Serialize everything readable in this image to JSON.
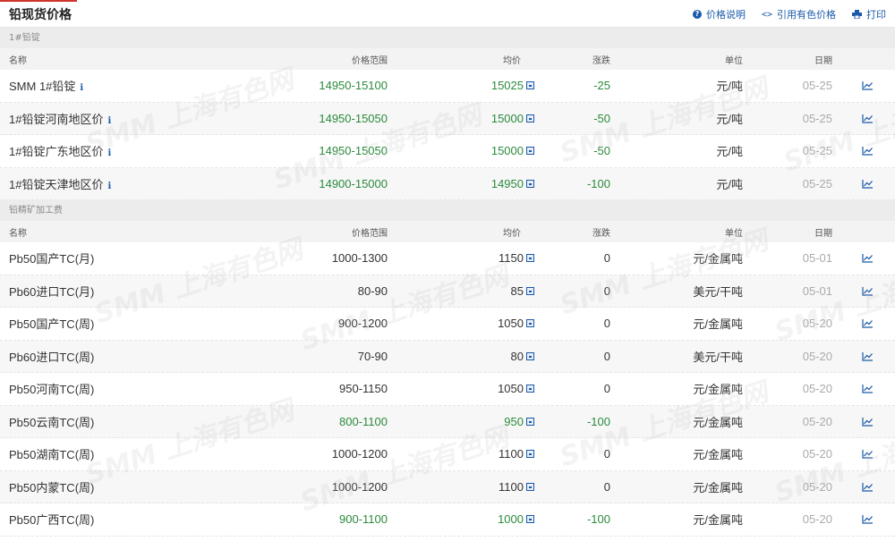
{
  "header": {
    "title": "铅现货价格",
    "actions": [
      {
        "label": "价格说明",
        "icon": "help-icon"
      },
      {
        "label": "引用有色价格",
        "icon": "code-icon"
      },
      {
        "label": "打印",
        "icon": "print-icon"
      }
    ]
  },
  "columns": {
    "name": "名称",
    "range": "价格范围",
    "avg": "均价",
    "change": "涨跌",
    "unit": "单位",
    "date": "日期"
  },
  "sections": [
    {
      "title": "1#铅锭",
      "rows": [
        {
          "name": "SMM 1#铅锭",
          "info": "i",
          "range": "14950-15100",
          "avg": "15025",
          "change": "-25",
          "unit": "元/吨",
          "date": "05-25",
          "green": true
        },
        {
          "name": "1#铅锭河南地区价",
          "info": "i",
          "range": "14950-15050",
          "avg": "15000",
          "change": "-50",
          "unit": "元/吨",
          "date": "05-25",
          "green": true
        },
        {
          "name": "1#铅锭广东地区价",
          "info": "i",
          "range": "14950-15050",
          "avg": "15000",
          "change": "-50",
          "unit": "元/吨",
          "date": "05-25",
          "green": true
        },
        {
          "name": "1#铅锭天津地区价",
          "info": "i",
          "range": "14900-15000",
          "avg": "14950",
          "change": "-100",
          "unit": "元/吨",
          "date": "05-25",
          "green": true
        }
      ]
    },
    {
      "title": "铅精矿加工费",
      "rows": [
        {
          "name": "Pb50国产TC(月)",
          "info": "",
          "range": "1000-1300",
          "avg": "1150",
          "change": "0",
          "unit": "元/金属吨",
          "date": "05-01",
          "green": false
        },
        {
          "name": "Pb60进口TC(月)",
          "info": "",
          "range": "80-90",
          "avg": "85",
          "change": "0",
          "unit": "美元/干吨",
          "date": "05-01",
          "green": false
        },
        {
          "name": "Pb50国产TC(周)",
          "info": "",
          "range": "900-1200",
          "avg": "1050",
          "change": "0",
          "unit": "元/金属吨",
          "date": "05-20",
          "green": false
        },
        {
          "name": "Pb60进口TC(周)",
          "info": "",
          "range": "70-90",
          "avg": "80",
          "change": "0",
          "unit": "美元/干吨",
          "date": "05-20",
          "green": false
        },
        {
          "name": "Pb50河南TC(周)",
          "info": "",
          "range": "950-1150",
          "avg": "1050",
          "change": "0",
          "unit": "元/金属吨",
          "date": "05-20",
          "green": false
        },
        {
          "name": "Pb50云南TC(周)",
          "info": "",
          "range": "800-1100",
          "avg": "950",
          "change": "-100",
          "unit": "元/金属吨",
          "date": "05-20",
          "green": true
        },
        {
          "name": "Pb50湖南TC(周)",
          "info": "",
          "range": "1000-1200",
          "avg": "1100",
          "change": "0",
          "unit": "元/金属吨",
          "date": "05-20",
          "green": false
        },
        {
          "name": "Pb50内蒙TC(周)",
          "info": "",
          "range": "1000-1200",
          "avg": "1100",
          "change": "0",
          "unit": "元/金属吨",
          "date": "05-20",
          "green": false
        },
        {
          "name": "Pb50广西TC(周)",
          "info": "",
          "range": "900-1100",
          "avg": "1000",
          "change": "-100",
          "unit": "元/金属吨",
          "date": "05-20",
          "green": true
        }
      ]
    }
  ],
  "watermark": "SMM 上海有色网",
  "colors": {
    "accent": "#1a5aa8",
    "down": "#2a8a3b",
    "title_underline": "#d0332b"
  }
}
